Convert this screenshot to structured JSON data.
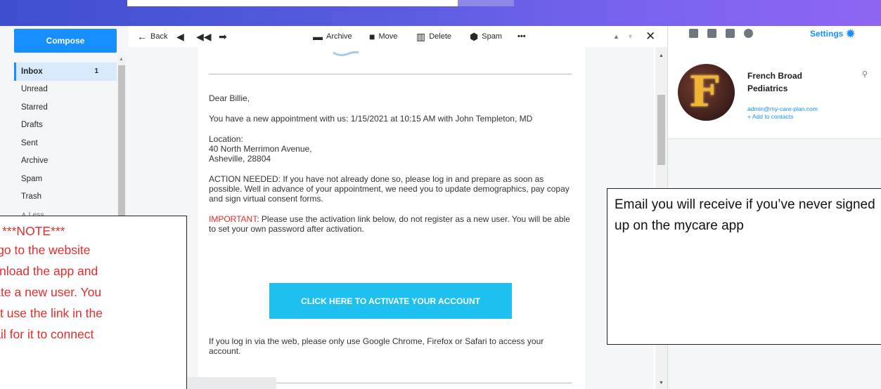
{
  "toolbar": {
    "back": "Back",
    "archive": "Archive",
    "move": "Move",
    "delete": "Delete",
    "spam": "Spam",
    "more": "•••"
  },
  "sidebar": {
    "compose": "Compose",
    "folders": [
      {
        "label": "Inbox",
        "count": "1"
      },
      {
        "label": "Unread"
      },
      {
        "label": "Starred"
      },
      {
        "label": "Drafts"
      },
      {
        "label": "Sent"
      },
      {
        "label": "Archive"
      },
      {
        "label": "Spam"
      },
      {
        "label": "Trash"
      },
      {
        "label": "∧ Less"
      }
    ]
  },
  "email": {
    "greeting": "Dear Billie,",
    "appointment": "You have a new appointment with us: 1/15/2021 at 10:15 AM with John Templeton, MD",
    "location_label": "Location:",
    "address1": "40 North Merrimon Avenue,",
    "address2": "Asheville, 28804",
    "action": "ACTION NEEDED: If you have not already done so, please log in and prepare as soon as possible. Well in advance of your appointment, we need you to update demographics, pay copay and sign virtual consent forms.",
    "important_label": "IMPORTANT",
    "important_text": ": Please use the activation link below, do not register as a new user. You will be able to set your own password after activation.",
    "cta": "CLICK HERE TO ACTIVATE YOUR ACCOUNT",
    "footer": "If you log in via the web, please only use Google Chrome, Firefox or Safari to access your account."
  },
  "right_panel": {
    "settings": "Settings",
    "sender_name": "French Broad Pediatrics",
    "sender_email": "admin@my-care-plan.com",
    "add_contact": "+ Add to contacts",
    "avatar_letter": "F"
  },
  "annotations": {
    "right_note": "Email you will receive if you’ve never signed up on the mycare app",
    "left_note_head": "***NOTE***",
    "left_note_lines": [
      "not go to the website",
      "download the app and",
      "create a new user. You",
      "must use the link in the",
      "email for it to connect"
    ]
  },
  "colors": {
    "accent": "#188fff",
    "cta": "#1ec0f0",
    "alert_red": "#e52c2c"
  }
}
